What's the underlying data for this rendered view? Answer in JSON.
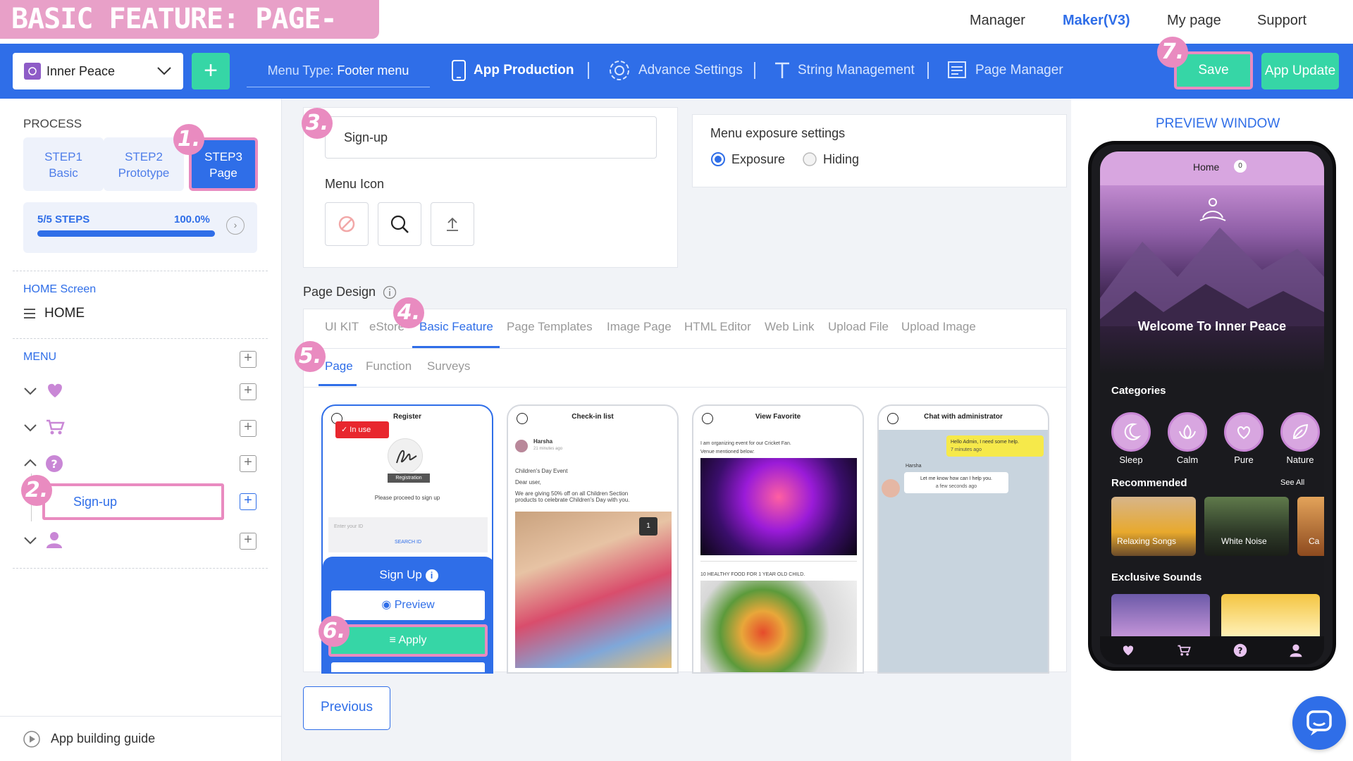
{
  "header": {
    "title_tag": "BASIC FEATURE: PAGE-REGISTER",
    "nav": [
      "Manager",
      "Maker(V3)",
      "My page",
      "Support"
    ],
    "active_nav": "Maker(V3)"
  },
  "toolbar": {
    "app_name": "Inner Peace",
    "add_label": "+",
    "menu_type_key": "Menu Type:",
    "menu_type_value": "Footer menu",
    "tabs": [
      "App Production",
      "Advance Settings",
      "String Management",
      "Page Manager"
    ],
    "save_label": "Save",
    "update_label": "App Update",
    "colors": {
      "bar": "#2f6ee8",
      "accent": "#36d6a6",
      "highlight": "#e98bc0"
    }
  },
  "badges": [
    "1.",
    "2.",
    "3.",
    "4.",
    "5.",
    "6.",
    "7."
  ],
  "sidebar": {
    "process_label": "PROCESS",
    "steps": [
      {
        "line1": "STEP1",
        "line2": "Basic"
      },
      {
        "line1": "STEP2",
        "line2": "Prototype"
      },
      {
        "line1": "STEP3",
        "line2": "Page"
      }
    ],
    "progress_label": "5/5 STEPS",
    "progress_pct_text": "100.0%",
    "progress_fraction": 1.0,
    "home_section": "HOME Screen",
    "home_item": "HOME",
    "menu_section": "MENU",
    "menu_items": [
      {
        "icon": "heart-icon"
      },
      {
        "icon": "cart-icon"
      },
      {
        "icon": "question-icon"
      },
      {
        "icon": "user-icon"
      }
    ],
    "submenu_item": "Sign-up",
    "guide_label": "App building guide"
  },
  "editor": {
    "page_name": "Sign-up",
    "menu_icon_label": "Menu Icon",
    "exposure_title": "Menu exposure settings",
    "exposure_options": [
      "Exposure",
      "Hiding"
    ],
    "exposure_selected": "Exposure",
    "page_design_label": "Page Design",
    "design_tabs": [
      "UI KIT",
      "eStore",
      "Basic Feature",
      "Page Templates",
      "Image Page",
      "HTML Editor",
      "Web Link",
      "Upload File",
      "Upload Image"
    ],
    "active_design_tab": "Basic Feature",
    "sub_tabs": [
      "Page",
      "Function",
      "Surveys"
    ],
    "active_sub_tab": "Page",
    "previous_label": "Previous"
  },
  "templates": [
    {
      "title": "Register",
      "in_use": "In use",
      "reg_label": "Registration",
      "proceed_text": "Please proceed to sign up",
      "id_placeholder": "Enter your ID",
      "search_id": "SEARCH ID",
      "signup_label": "Sign Up",
      "preview_label": "Preview",
      "apply_label": "Apply"
    },
    {
      "title": "Check-in list",
      "user": "Harsha",
      "time": "21 minutes ago",
      "line1": "Children's Day Event",
      "line2": "Dear user,",
      "line3": "We are giving 50% off on all Children Section products to celebrate Children's Day with you.",
      "photo_count": "1"
    },
    {
      "title": "View Favorite",
      "line1": "I am organizing event for our Cricket Fan.",
      "line2": "Venue mentioned below:",
      "line3": "10 HEALTHY FOOD FOR 1 YEAR OLD CHILD."
    },
    {
      "title": "Chat with administrator",
      "msg1": "Hello Admin, I need some help.",
      "msg1_time": "7 minutes ago",
      "user": "Harsha",
      "msg2": "Let me know how can I help you.",
      "msg2_time": "a few seconds ago"
    }
  ],
  "preview": {
    "title": "PREVIEW WINDOW",
    "home_label": "Home",
    "home_count": "0",
    "welcome": "Welcome To Inner Peace",
    "categories_label": "Categories",
    "categories": [
      "Sleep",
      "Calm",
      "Pure",
      "Nature"
    ],
    "recommended_label": "Recommended",
    "see_all": "See All",
    "recommended": [
      "Relaxing Songs",
      "White Noise",
      "Ca"
    ],
    "exclusive_label": "Exclusive Sounds",
    "footer_icons": [
      "heart-icon",
      "cart-icon",
      "question-icon",
      "user-icon"
    ]
  }
}
